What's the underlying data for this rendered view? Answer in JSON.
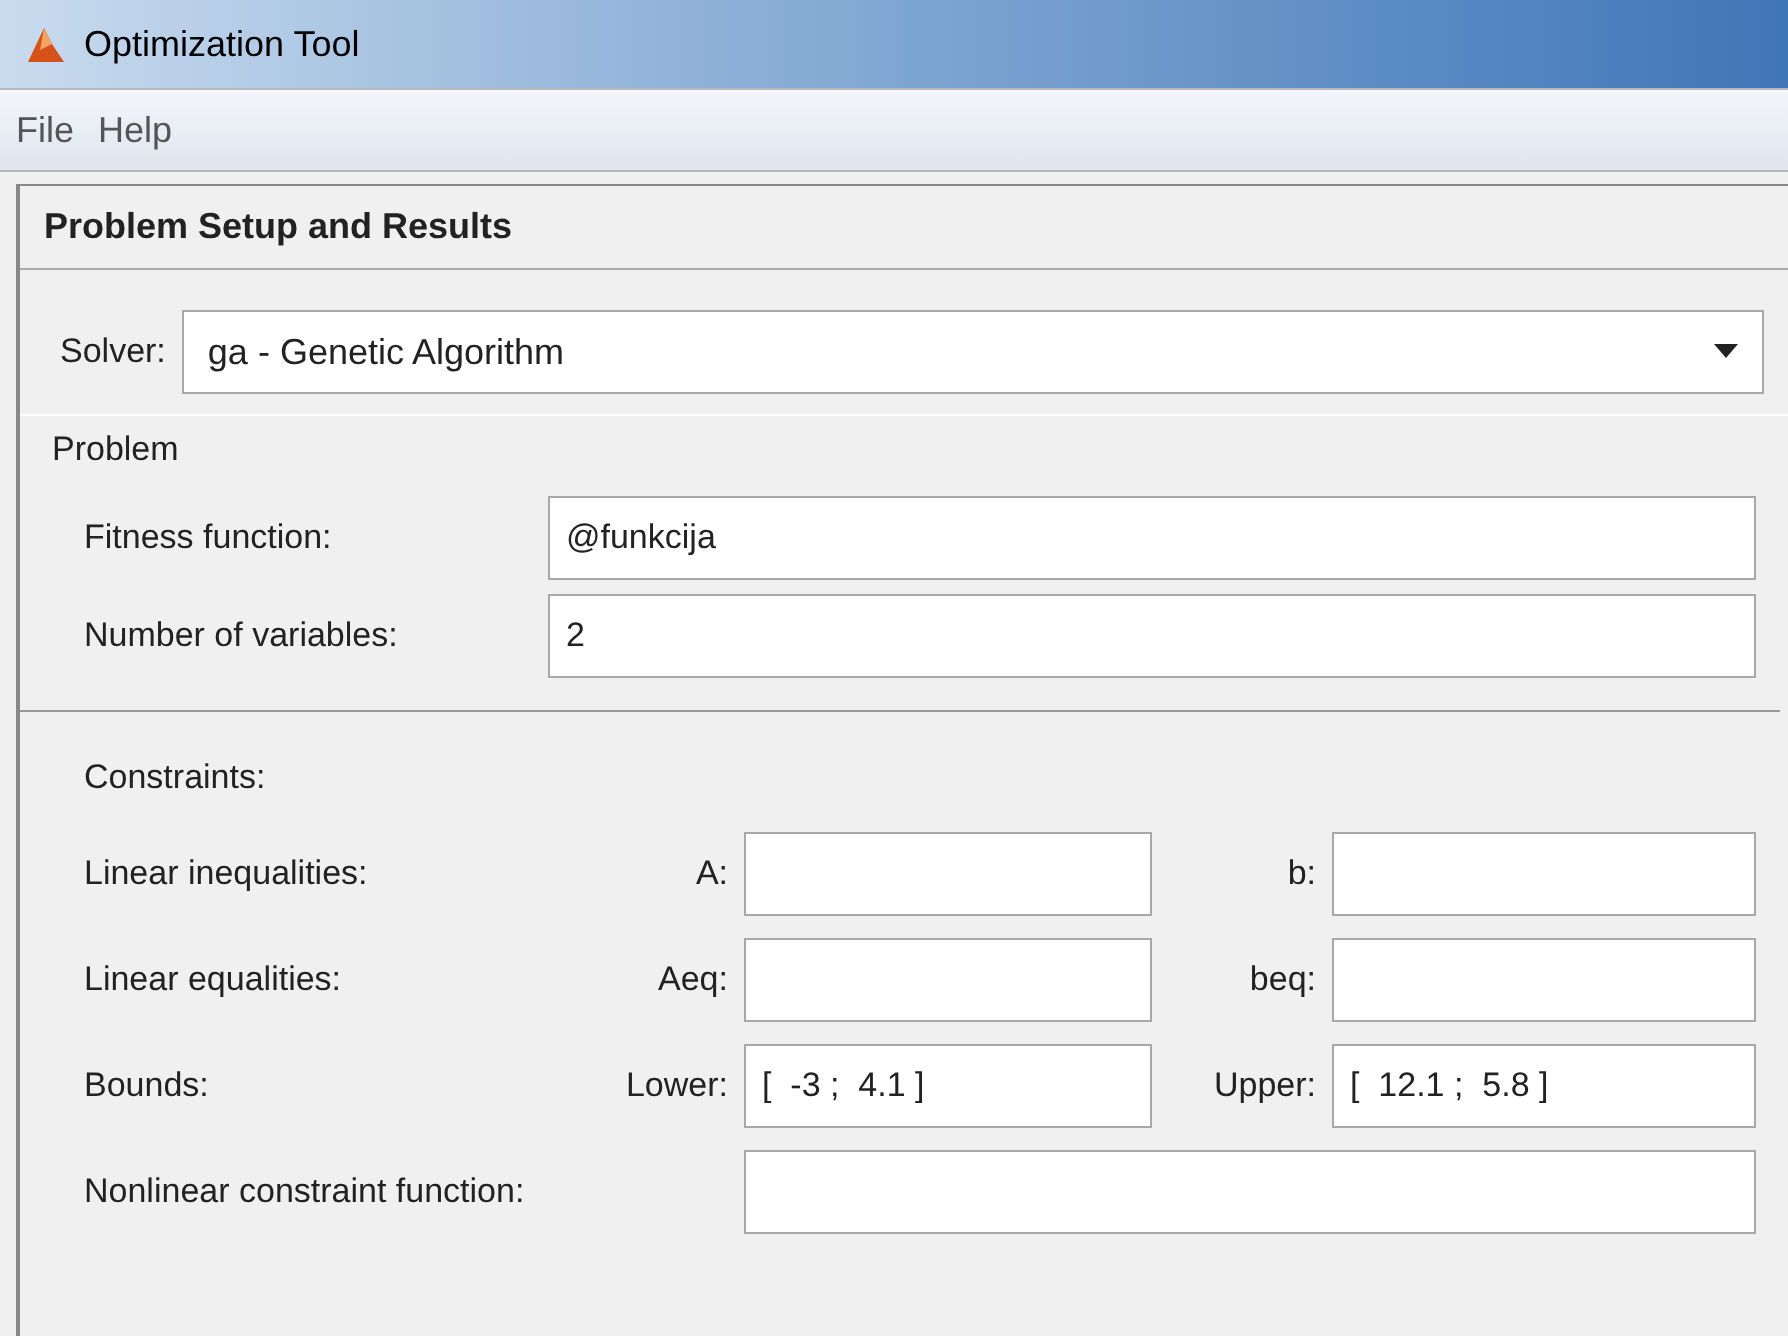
{
  "window": {
    "title": "Optimization Tool"
  },
  "menu": [
    "File",
    "Help"
  ],
  "panel": {
    "title": "Problem Setup and Results"
  },
  "solver": {
    "label": "Solver:",
    "value": "ga - Genetic Algorithm"
  },
  "problem": {
    "title": "Problem",
    "fields": [
      {
        "label": "Fitness function:",
        "value": "@funkcija"
      },
      {
        "label": "Number of variables:",
        "value": "2"
      }
    ]
  },
  "constraints": {
    "title": "Constraints:",
    "rows": [
      {
        "label": "Linear inequalities:",
        "left_label": "A:",
        "right_label": "b:"
      },
      {
        "label": "Linear equalities:",
        "left_label": "Aeq:",
        "right_label": "beq:"
      },
      {
        "label": "Bounds:",
        "left_label": "Lower:",
        "left_value": "[  -3 ;  4.1 ]",
        "right_label": "Upper:",
        "right_value": "[  12.1 ;  5.8 ]"
      }
    ],
    "nonlinear": {
      "label": "Nonlinear constraint function:"
    }
  }
}
